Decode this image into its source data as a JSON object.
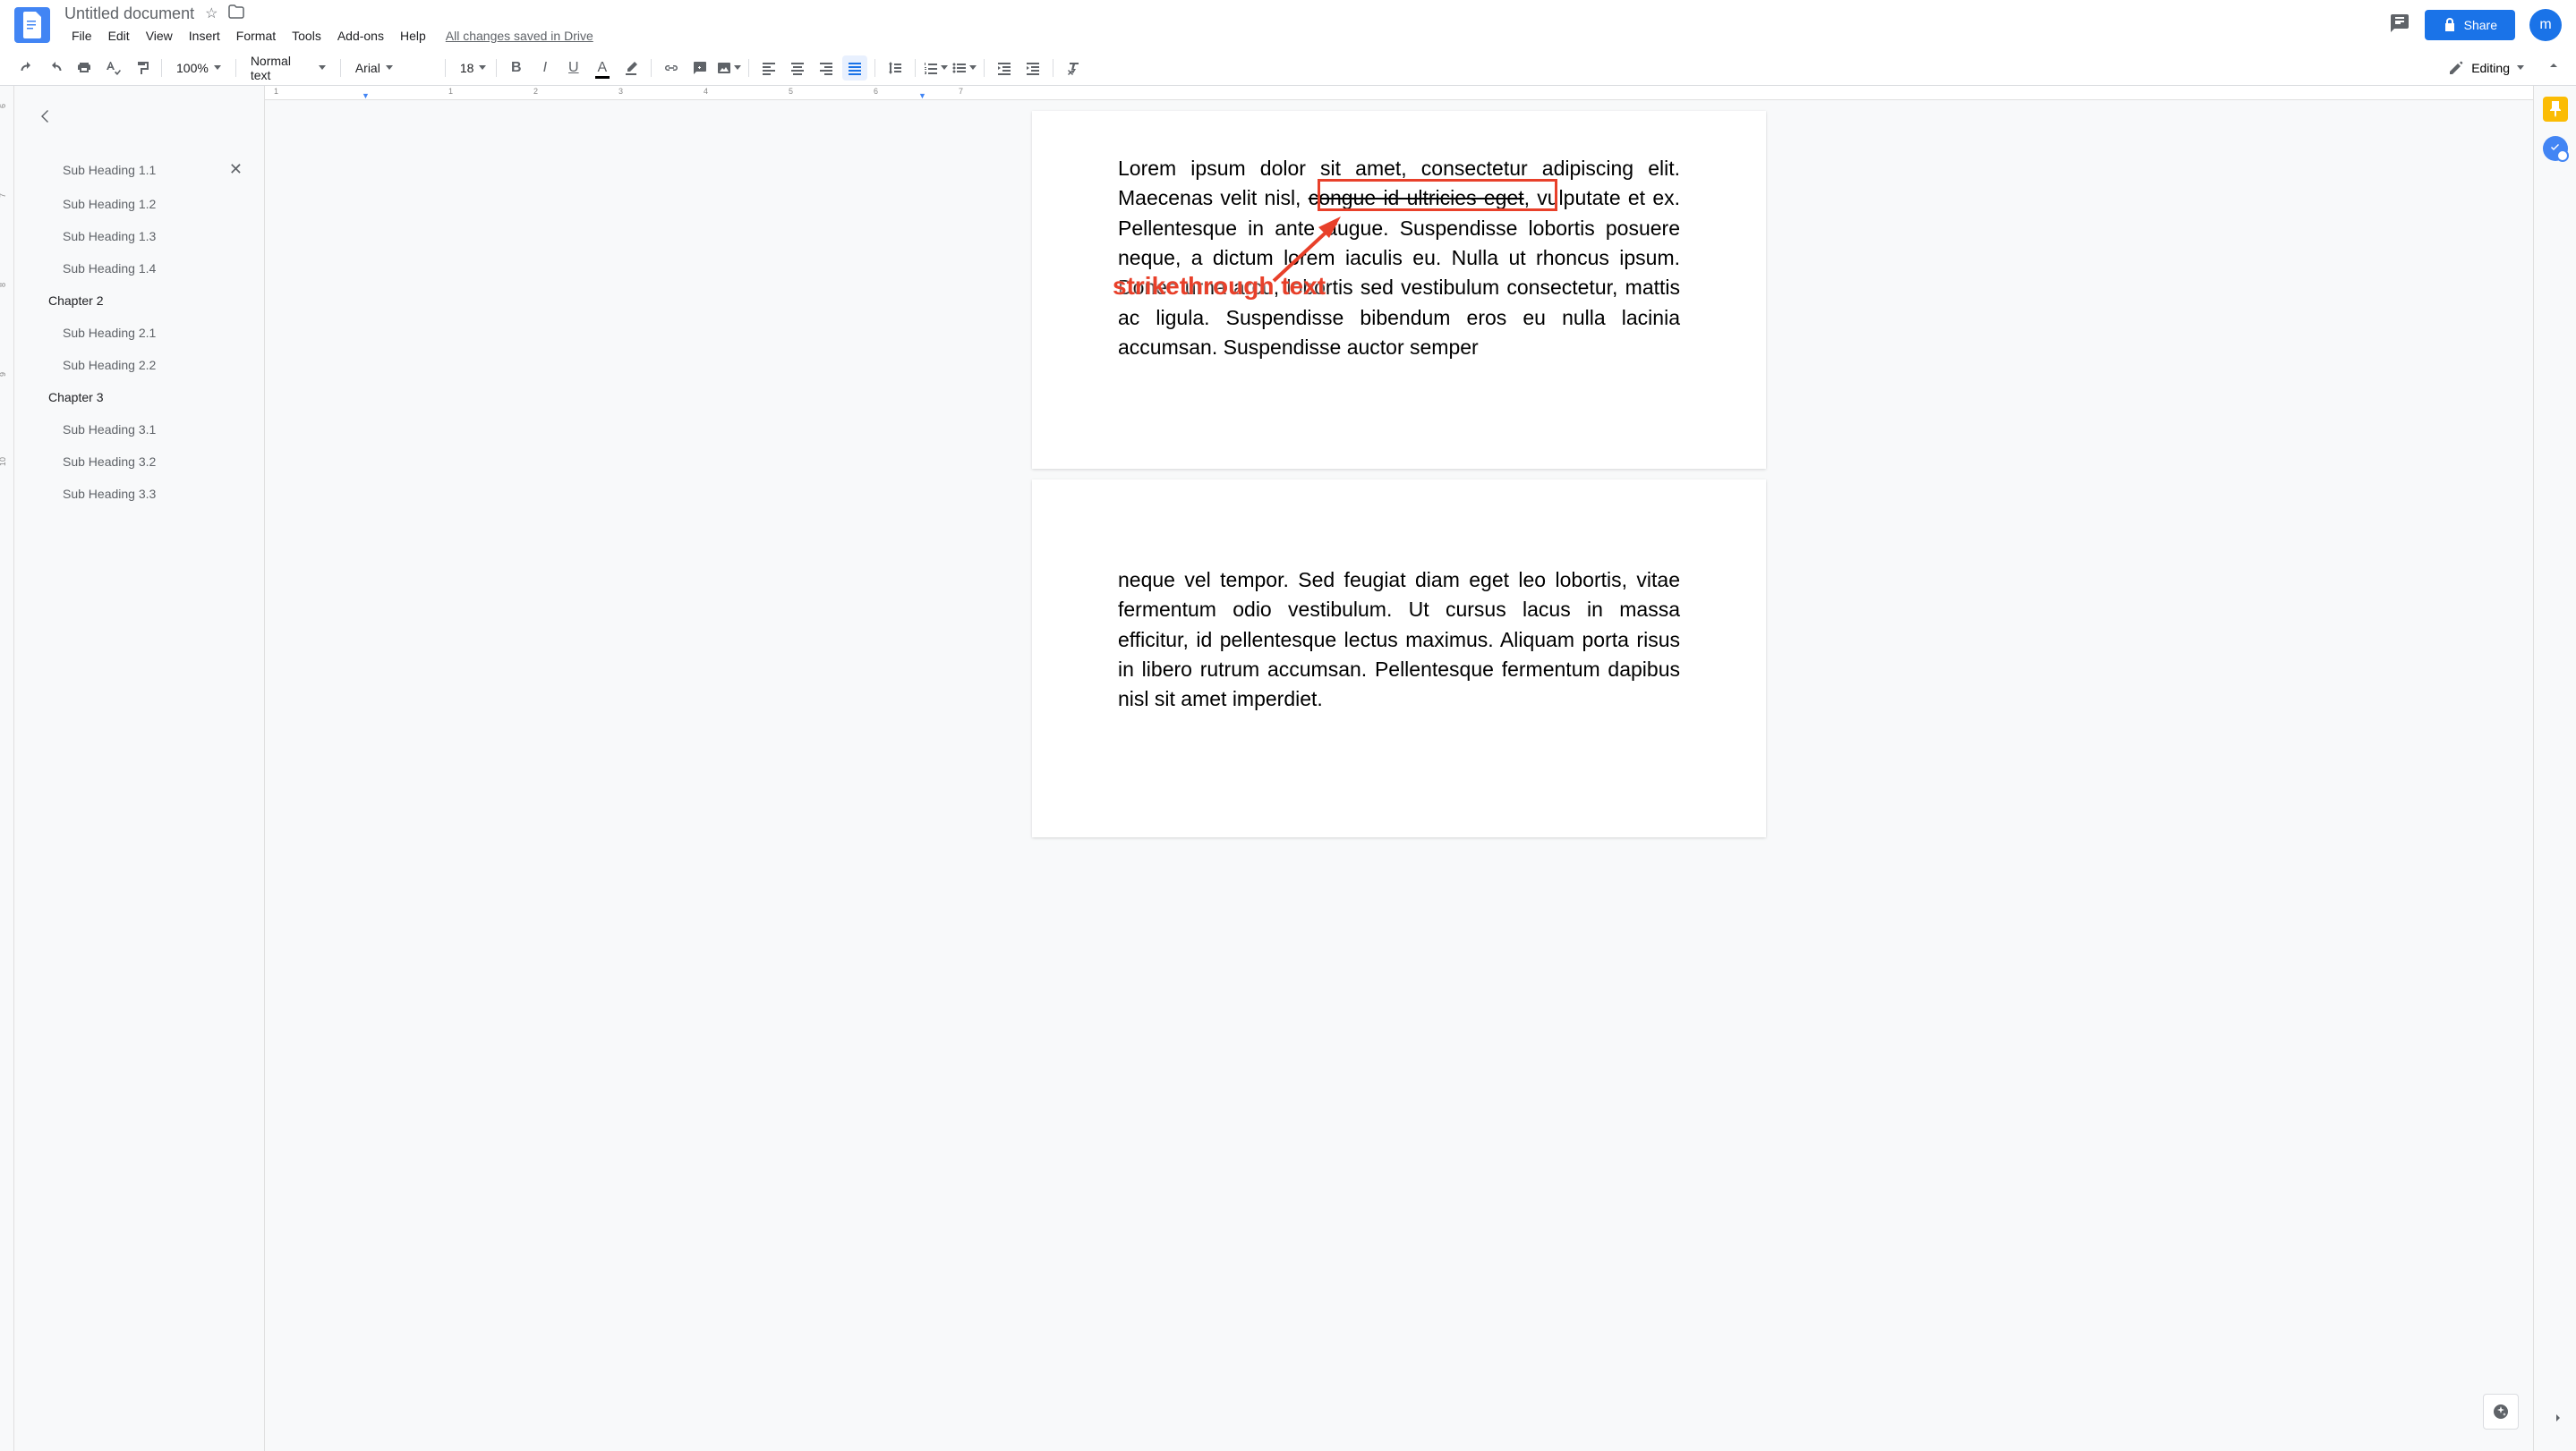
{
  "header": {
    "title": "Untitled document",
    "save_status": "All changes saved in Drive",
    "share_label": "Share",
    "avatar_letter": "m"
  },
  "menu": {
    "file": "File",
    "edit": "Edit",
    "view": "View",
    "insert": "Insert",
    "format": "Format",
    "tools": "Tools",
    "addons": "Add-ons",
    "help": "Help"
  },
  "toolbar": {
    "zoom": "100%",
    "style": "Normal text",
    "font": "Arial",
    "size": "18",
    "editing_label": "Editing"
  },
  "ruler_h": [
    "1",
    "2",
    "3",
    "4",
    "5",
    "6",
    "7"
  ],
  "ruler_h_left": "1",
  "ruler_v": [
    "6",
    "7",
    "8",
    "9",
    "10"
  ],
  "outline": {
    "active": "Sub Heading 1.1",
    "items": [
      {
        "label": "Sub Heading 1.1",
        "level": 1,
        "active": true
      },
      {
        "label": "Sub Heading 1.2",
        "level": 1
      },
      {
        "label": "Sub Heading 1.3",
        "level": 1
      },
      {
        "label": "Sub Heading 1.4",
        "level": 1
      },
      {
        "label": "Chapter 2",
        "level": 0
      },
      {
        "label": "Sub Heading 2.1",
        "level": 1
      },
      {
        "label": "Sub Heading 2.2",
        "level": 1
      },
      {
        "label": "Chapter 3",
        "level": 0
      },
      {
        "label": "Sub Heading 3.1",
        "level": 1
      },
      {
        "label": "Sub Heading 3.2",
        "level": 1
      },
      {
        "label": "Sub Heading 3.3",
        "level": 1
      }
    ]
  },
  "doc": {
    "page1_before": "Lorem ipsum dolor sit amet, consectetur adipiscing elit. Maecenas velit nisl, ",
    "page1_strike": "congue id ultricies eget",
    "page1_after": ", vulputate et ex. Pellentesque in ante augue. Suspendisse lobortis posuere neque, a dictum lorem iaculis eu. Nulla ut rhoncus ipsum. Donec urna arcu, lobortis sed vestibulum consectetur, mattis ac ligula. Suspendisse bibendum eros eu nulla lacinia accumsan. Suspendisse auctor semper",
    "page2": "neque vel tempor. Sed feugiat diam eget leo lobortis, vitae fermentum odio vestibulum. Ut cursus lacus in massa efficitur, id pellentesque lectus maximus. Aliquam porta risus in libero rutrum accumsan. Pellentesque fermentum dapibus nisl sit amet imperdiet."
  },
  "annotation": {
    "label": "strikethrough text"
  }
}
